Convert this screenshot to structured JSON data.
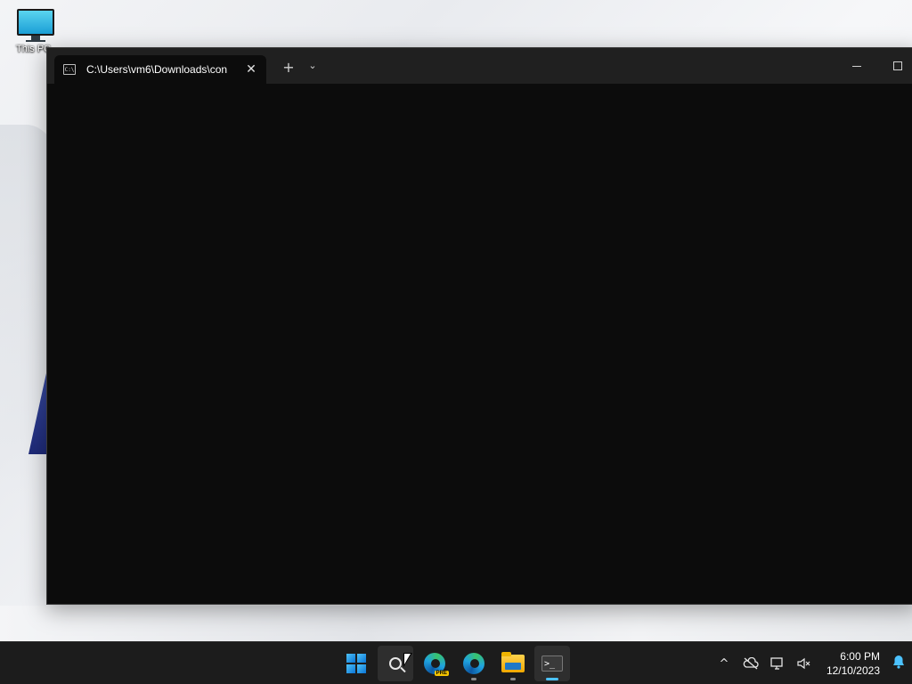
{
  "desktop": {
    "icons": [
      {
        "label": "This PC",
        "icon": "this-pc-icon"
      }
    ]
  },
  "terminal_window": {
    "tab": {
      "title": "C:\\Users\\vm6\\Downloads\\con",
      "icon": "cmd-icon",
      "close_glyph": "✕"
    },
    "new_tab_glyph": "+",
    "dropdown_glyph": "⌄",
    "controls": [
      "minimize",
      "maximize"
    ]
  },
  "taskbar": {
    "apps": [
      {
        "name": "Start",
        "icon": "windows-start-icon",
        "running": false
      },
      {
        "name": "Search",
        "icon": "search-icon",
        "running": false,
        "hover": true
      },
      {
        "name": "Microsoft Edge Preview",
        "icon": "edge-preview-icon",
        "badge": "PRE",
        "running": false
      },
      {
        "name": "Microsoft Edge",
        "icon": "edge-icon",
        "running": true
      },
      {
        "name": "File Explorer",
        "icon": "folder-icon",
        "running": true
      },
      {
        "name": "Terminal",
        "icon": "terminal-icon",
        "running": true,
        "active": true
      }
    ],
    "tray": {
      "overflow_glyph": "^",
      "icons": [
        "chevron-up-icon",
        "onedrive-offline-icon",
        "network-icon",
        "volume-muted-icon"
      ],
      "time": "6:00 PM",
      "date": "12/10/2023",
      "notification_icon": "bell-icon"
    }
  },
  "colors": {
    "accent": "#4cc2ff",
    "taskbar_bg": "#1c1c1c",
    "terminal_bg": "#0c0c0c",
    "titlebar_bg": "#202020"
  }
}
